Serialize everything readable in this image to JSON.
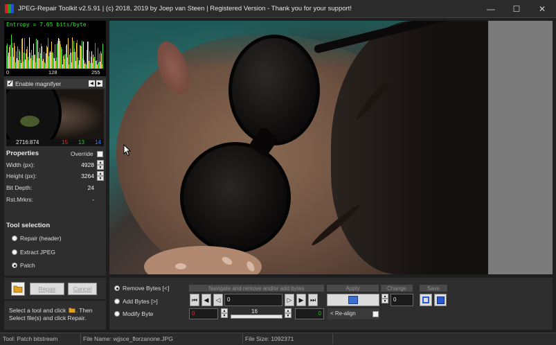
{
  "window": {
    "title": "JPEG-Repair Toolkit v2.5.91 | (c) 2018, 2019 by Joep van Steen | Registered Version - Thank you for your support!",
    "min_glyph": "—",
    "max_glyph": "☐",
    "close_glyph": "✕"
  },
  "histogram": {
    "entropy_label": "Entropy = 7.65 bits/byte",
    "axis_min": "0",
    "axis_mid": "128",
    "axis_max": "255"
  },
  "magnifier": {
    "label": "Enable magnifyer",
    "checked": true,
    "coord": "2716:874",
    "r": "15",
    "g": "13",
    "b": "14",
    "prev_glyph": "◀",
    "next_glyph": "▶"
  },
  "properties": {
    "title": "Properties",
    "override_label": "Override",
    "width_label": "Width (px):",
    "width_value": "4928",
    "height_label": "Height (px):",
    "height_value": "3264",
    "bitdepth_label": "Bit Depth:",
    "bitdepth_value": "24",
    "rst_label": "Rst.Mrkrs:",
    "rst_value": "-"
  },
  "tools": {
    "title": "Tool selection",
    "options": [
      "Repair (header)",
      "Extract JPEG",
      "Patch"
    ],
    "selected": "Patch"
  },
  "actions": {
    "repair": "Repair",
    "cancel": "Cancel"
  },
  "hint": {
    "line1_a": "Select a tool and click",
    "line1_b": ". Then",
    "line2": "Select file(s) and click Repair."
  },
  "patch": {
    "mode_options": [
      "Remove Bytes [<]",
      "Add Bytes [>]",
      "Modify Byte"
    ],
    "selected_mode": "Remove Bytes [<]",
    "navigate_header": "Navigate and remove and/or add bytes",
    "apply_header": "Apply",
    "change_header": "Change",
    "save_header": "Save",
    "offset_value": "0",
    "change_value": "0",
    "modify_value": "0",
    "slider_value": "16",
    "right_value": "0",
    "realign_label": "< Re-align"
  },
  "status": {
    "tool": "Tool: Patch bitstream",
    "file_name": "File Name: wjjsce_florzanone.JPG",
    "file_size": "File Size: 1092371"
  },
  "colors": {
    "background": "#1e1e1e",
    "panel": "#2e2e2e",
    "entropy_green": "#35e035",
    "red": "#e03030",
    "green": "#30c030",
    "blue": "#3a7bff",
    "viewer_gray": "#7a7a7a"
  },
  "icons": {
    "folder": "folder-icon",
    "apply": "apply-icon",
    "save_a": "save-frame-icon",
    "save_b": "save-disk-icon"
  }
}
